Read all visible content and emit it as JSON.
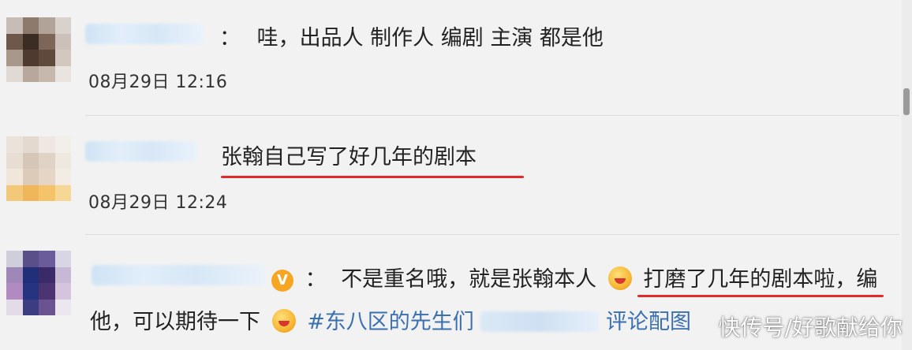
{
  "comments": [
    {
      "username": "",
      "separator": "：",
      "text": "哇，出品人 制作人 编剧 主演 都是他",
      "timestamp": "08月29日 12:16"
    },
    {
      "username": "",
      "text": "张翰自己写了好几年的剧本",
      "timestamp": "08月29日 12:24"
    },
    {
      "username": "",
      "badge": "V",
      "separator": "：",
      "text_part1": "不是重名哦，就是张翰本人",
      "text_part2": "打磨了几年的剧本啦，编",
      "line2_part1": "他，可以期待一下",
      "hashtag": "#东八区的先生们",
      "line2_tail": "评论配图"
    }
  ],
  "watermark": "快传号/好歌献给你",
  "colors": {
    "background": "#f2f2f2",
    "underline": "#e02b2b",
    "hashtag": "#3a6fb0",
    "username_blur": "#cfe3f5"
  }
}
